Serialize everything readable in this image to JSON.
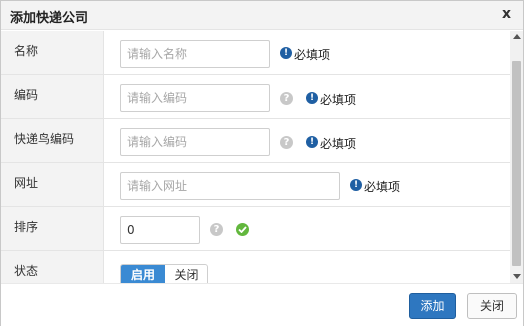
{
  "dialog": {
    "title": "添加快递公司",
    "close_label": "x"
  },
  "form": {
    "rows": [
      {
        "label": "名称",
        "placeholder": "请输入名称",
        "value": "",
        "required_text": "必填项"
      },
      {
        "label": "编码",
        "placeholder": "请输入编码",
        "value": "",
        "required_text": "必填项"
      },
      {
        "label": "快递鸟编码",
        "placeholder": "请输入编码",
        "value": "",
        "required_text": "必填项"
      },
      {
        "label": "网址",
        "placeholder": "请输入网址",
        "value": "",
        "required_text": "必填项"
      },
      {
        "label": "排序",
        "placeholder": "",
        "value": "0"
      },
      {
        "label": "状态",
        "toggle_on": "启用",
        "toggle_off": "关闭"
      }
    ],
    "help_glyph": "?",
    "required_glyph": "!"
  },
  "footer": {
    "add_label": "添加",
    "close_label": "关闭"
  },
  "colors": {
    "primary": "#2e77c0",
    "required_icon": "#1f5fa3",
    "ok_icon": "#62b73d",
    "label_bg": "#f3f3f3"
  },
  "icons": [
    "help-icon",
    "required-icon",
    "check-icon",
    "close-icon",
    "scroll-up-arrow",
    "scroll-down-arrow"
  ]
}
